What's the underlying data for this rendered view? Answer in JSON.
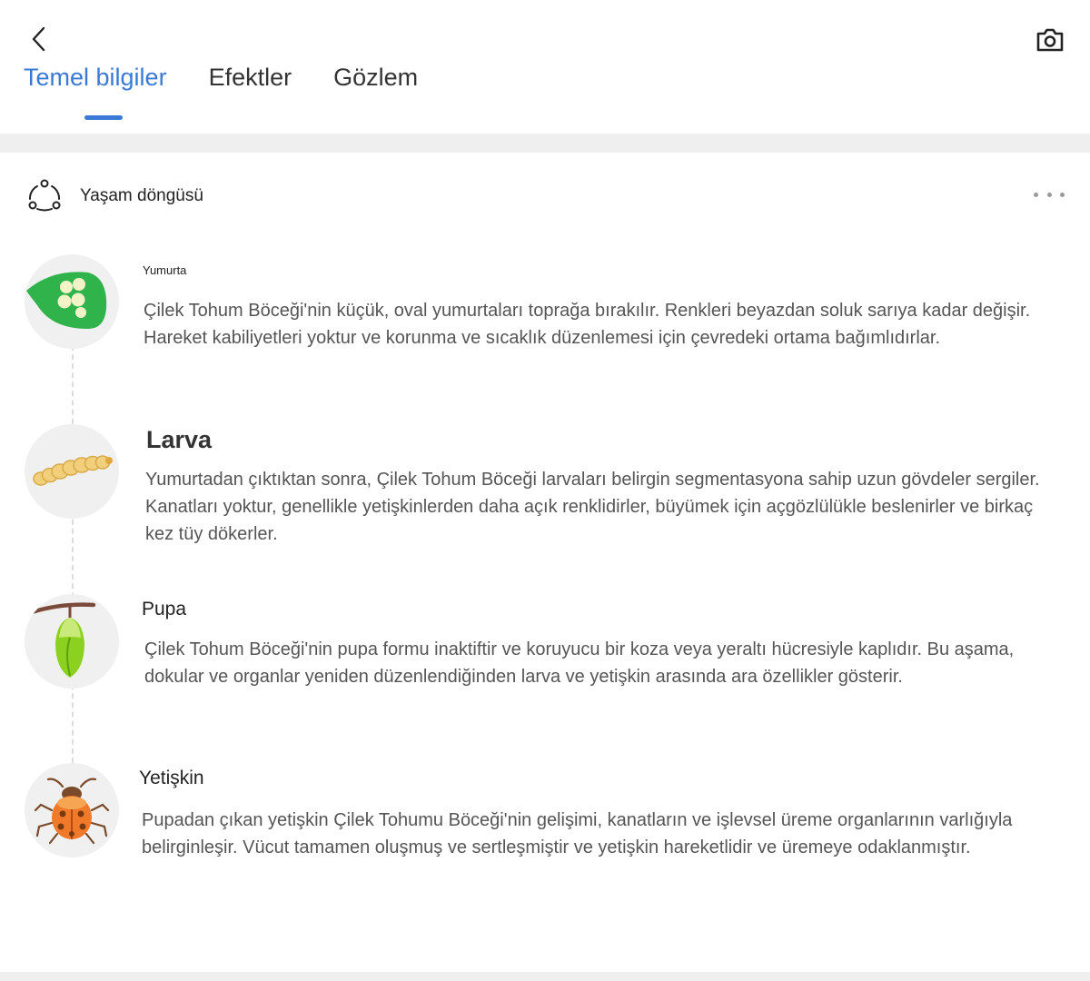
{
  "header": {
    "back_icon": "chevron-left-icon",
    "camera_icon": "camera-icon",
    "tabs": [
      {
        "label": "Temel bilgiler",
        "active": true
      },
      {
        "label": "Efektler",
        "active": false
      },
      {
        "label": "Gözlem",
        "active": false
      }
    ]
  },
  "section": {
    "icon": "lifecycle-icon",
    "title": "Yaşam döngüsü",
    "more_icon": "more-dots-icon"
  },
  "colors": {
    "accent": "#3a7ad6",
    "leaf_green": "#2fb34a",
    "larva_yellow": "#f2cf7a",
    "pupa_green": "#8cd11f",
    "beetle_orange": "#f07a2a"
  },
  "stages": [
    {
      "title": "Yumurta",
      "icon": "egg-leaf-icon",
      "description": "Çilek Tohum Böceği'nin küçük, oval yumurtaları toprağa bırakılır. Renkleri beyazdan soluk sarıya kadar değişir. Hareket kabiliyetleri yoktur ve korunma ve sıcaklık düzenlemesi için çevredeki ortama bağımlıdırlar."
    },
    {
      "title": "Larva",
      "icon": "larva-icon",
      "description": "Yumurtadan çıktıktan sonra, Çilek Tohum Böceği larvaları belirgin segmentasyona sahip uzun gövdeler sergiler. Kanatları yoktur, genellikle yetişkinlerden daha açık renklidirler, büyümek için açgözlülükle beslenirler ve birkaç kez tüy dökerler."
    },
    {
      "title": "Pupa",
      "icon": "pupa-icon",
      "description": "Çilek Tohum Böceği'nin pupa formu inaktiftir ve koruyucu bir koza veya yeraltı hücresiyle kaplıdır. Bu aşama, dokular ve organlar yeniden düzenlendiğinden larva ve yetişkin arasında ara özellikler gösterir."
    },
    {
      "title": "Yetişkin",
      "icon": "beetle-icon",
      "description": "Pupadan çıkan yetişkin Çilek Tohumu Böceği'nin gelişimi, kanatların ve işlevsel üreme organlarının varlığıyla belirginleşir. Vücut tamamen oluşmuş ve sertleşmiştir ve yetişkin hareketlidir ve üremeye odaklanmıştır."
    }
  ]
}
